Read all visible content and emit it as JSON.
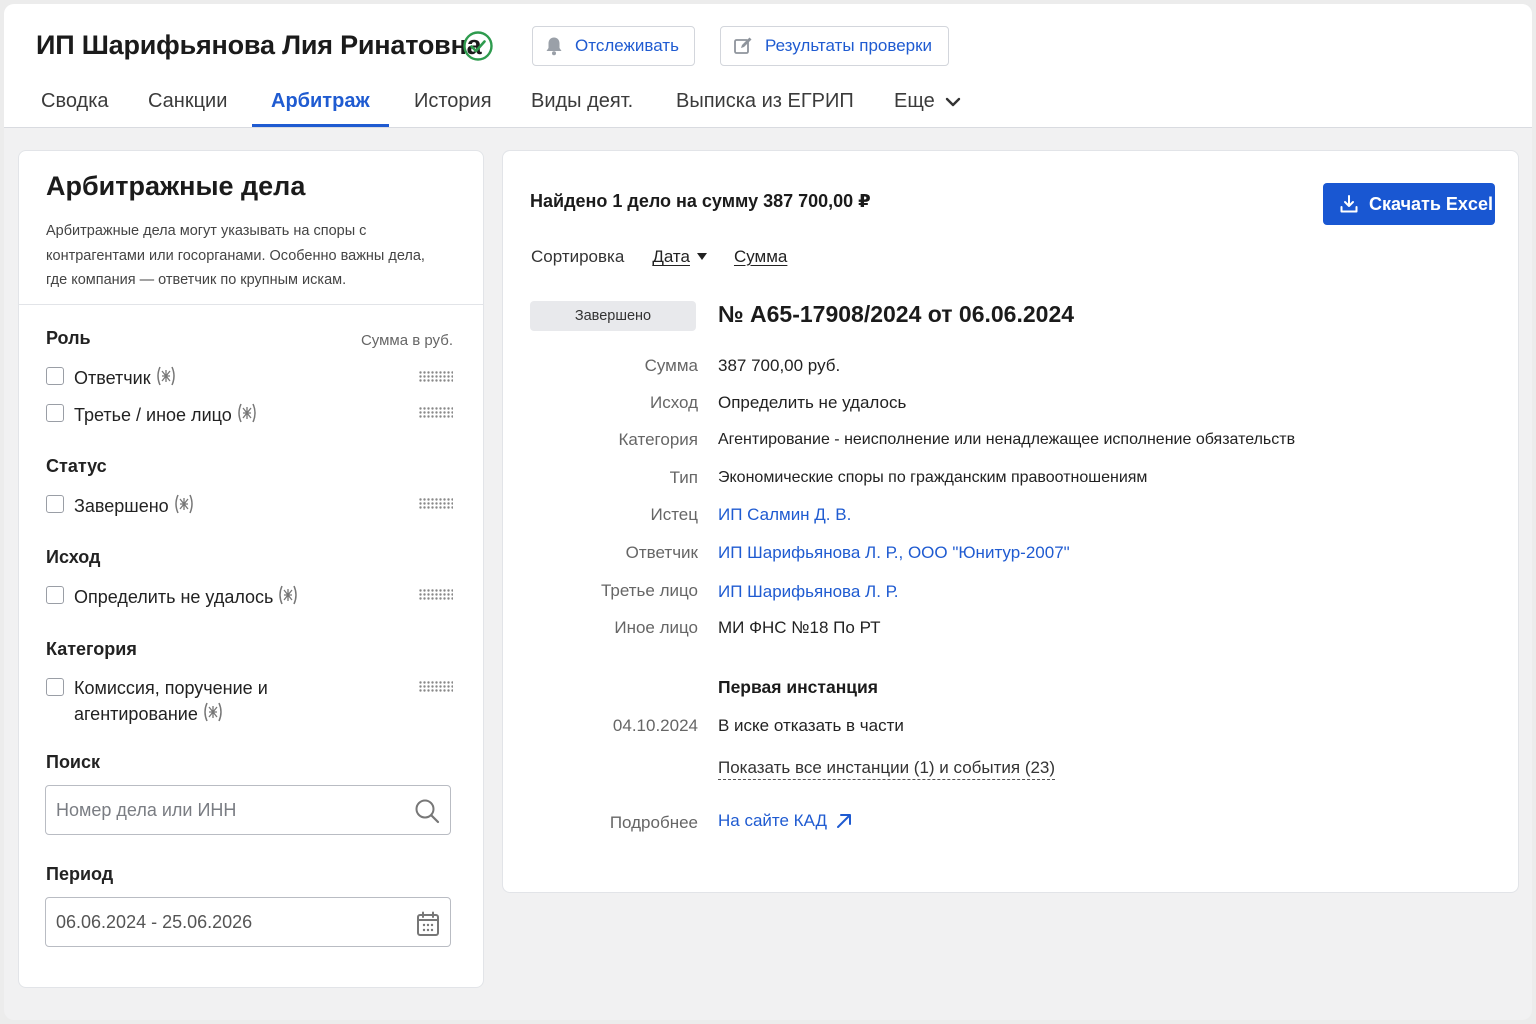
{
  "header": {
    "company_name": "ИП Шарифьянова Лия Ринатовна",
    "follow_label": "Отслеживать",
    "results_label": "Результаты проверки"
  },
  "tabs": [
    {
      "label": "Сводка",
      "active": false
    },
    {
      "label": "Санкции",
      "active": false
    },
    {
      "label": "Арбитраж",
      "active": true
    },
    {
      "label": "История",
      "active": false
    },
    {
      "label": "Виды деят.",
      "active": false
    },
    {
      "label": "Выписка из ЕГРИП",
      "active": false
    },
    {
      "label": "Еще",
      "active": false
    }
  ],
  "filters": {
    "title": "Арбитражные дела",
    "description": "Арбитражные дела могут указывать на споры с контрагентами или госорганами. Особенно важны дела, где компания — ответчик по крупным искам.",
    "sum_header": "Сумма в руб.",
    "groups": [
      {
        "title": "Роль",
        "options": [
          "Ответчик",
          "Третье / иное лицо"
        ]
      },
      {
        "title": "Статус",
        "options": [
          "Завершено"
        ]
      },
      {
        "title": "Исход",
        "options": [
          "Определить не удалось"
        ]
      },
      {
        "title": "Категория",
        "options": [
          "Комиссия, поручение и агентирование"
        ]
      }
    ],
    "search": {
      "title": "Поиск",
      "placeholder": "Номер дела или ИНН",
      "value": ""
    },
    "period": {
      "title": "Период",
      "value": "06.06.2024 - 25.06.2026"
    }
  },
  "results": {
    "found_text": "Найдено 1 дело на сумму 387 700,00 ₽",
    "excel_label": "Скачать Excel",
    "sort_label": "Сортировка",
    "sort_options": [
      "Дата",
      "Сумма"
    ]
  },
  "case": {
    "status": "Завершено",
    "number": "№ А65-17908/2024 от 06.06.2024",
    "rows": [
      {
        "label": "Сумма",
        "value": "387 700,00 руб.",
        "link": false
      },
      {
        "label": "Исход",
        "value": "Определить не удалось",
        "link": false
      },
      {
        "label": "Категория",
        "value": "Агентирование - неисполнение или ненадлежащее исполнение обязательств",
        "link": false
      },
      {
        "label": "Тип",
        "value": "Экономические споры по гражданским правоотношениям",
        "link": false
      },
      {
        "label": "Истец",
        "value": "ИП Салмин Д. В.",
        "link": true
      },
      {
        "label": "Ответчик",
        "value": "ИП Шарифьянова Л. Р., ООО \"Юнитур-2007\"",
        "link": true
      },
      {
        "label": "Третье лицо",
        "value": "ИП Шарифьянова Л. Р.",
        "link": true
      },
      {
        "label": "Иное лицо",
        "value": "МИ ФНС №18 По РТ",
        "link": false
      }
    ],
    "instance_title": "Первая инстанция",
    "instance_date": "04.10.2024",
    "instance_result": "В иске отказать в части",
    "show_all_link": "Показать все инстанции (1) и события (23)",
    "more_label": "Подробнее",
    "kad_link": "На сайте КАД"
  },
  "colors": {
    "accent": "#1f5bd1",
    "button_primary": "#1957d2",
    "verified": "#2e9b4e",
    "badge_bg": "#e8e9ec"
  }
}
